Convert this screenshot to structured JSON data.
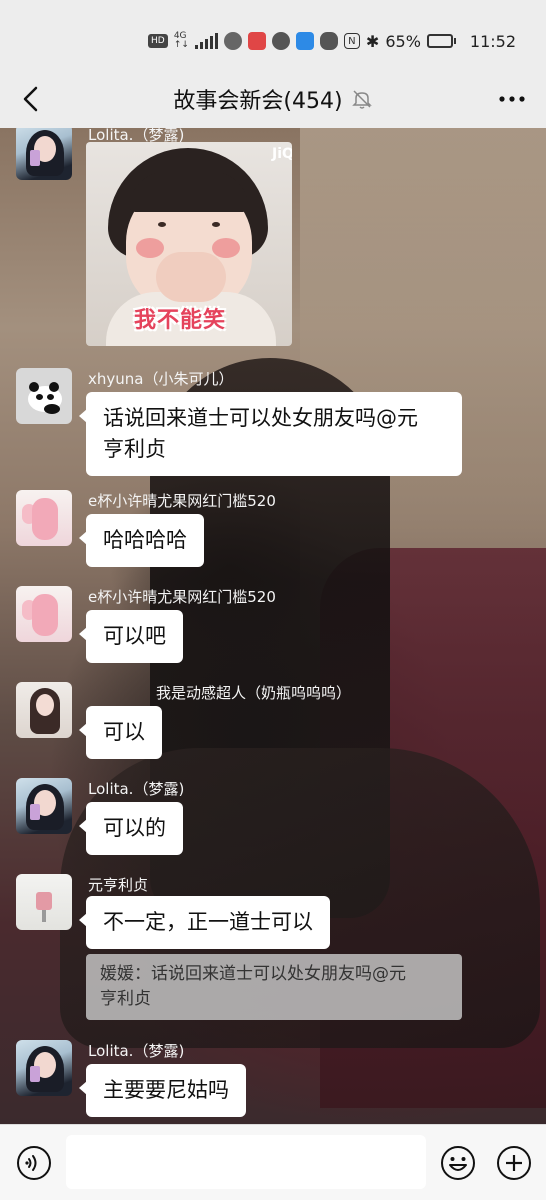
{
  "status_bar": {
    "hd": "HD",
    "network_top": "4G",
    "network_bottom": "↑↓",
    "battery_percent": "65%",
    "battery_level": 0.65,
    "time": "11:52"
  },
  "header": {
    "title": "故事会新会(454)",
    "icons": [
      "back-arrow-icon",
      "mute-bell-icon",
      "more-dots-icon"
    ]
  },
  "messages": [
    {
      "sender": "Lolita.（梦露)",
      "type": "sticker",
      "sticker_text": "我不能笑",
      "avatar": "lolita",
      "sticker_corner": "JiQ"
    },
    {
      "sender": "xhyuna（小朱可儿）",
      "type": "text",
      "lines": [
        "话说回来道士可以处女朋友吗@元",
        "亨利贞"
      ],
      "avatar": "panda"
    },
    {
      "sender": "e杯小许晴尤果网红门槛520",
      "type": "text",
      "lines": [
        "哈哈哈哈"
      ],
      "avatar": "pink"
    },
    {
      "sender": "e杯小许晴尤果网红门槛520",
      "type": "text",
      "lines": [
        "可以吧"
      ],
      "avatar": "pink"
    },
    {
      "sender": "我是动感超人（奶瓶呜呜呜）",
      "type": "text",
      "lines": [
        "可以"
      ],
      "avatar": "girl"
    },
    {
      "sender": "Lolita.（梦露)",
      "type": "text",
      "lines": [
        "可以的"
      ],
      "avatar": "lolita"
    },
    {
      "sender": "元亨利贞",
      "type": "text",
      "lines": [
        "不一定，正一道士可以"
      ],
      "avatar": "cake",
      "quote_lines": [
        "媛媛：话说回来道士可以处女朋友吗@元",
        "亨利贞"
      ]
    },
    {
      "sender": "Lolita.（梦露)",
      "type": "text",
      "lines": [
        "主要要尼姑吗"
      ],
      "avatar": "lolita"
    }
  ],
  "input_bar": {
    "placeholder": "",
    "icons": [
      "voice-icon",
      "emoji-icon",
      "plus-icon"
    ]
  },
  "colors": {
    "background": "#ededed",
    "bubble": "#ffffff",
    "sender_text": "#f4f4f4",
    "quote_bg": "#c8c8c8"
  }
}
